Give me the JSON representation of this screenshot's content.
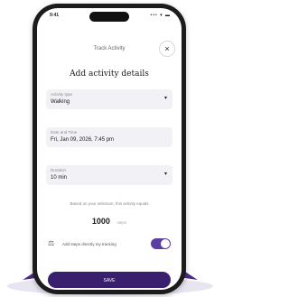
{
  "status_bar": {
    "time": "9:41",
    "icons": "••• ▾ ▬"
  },
  "nav": {
    "title": "Track Activity",
    "close_label": "×"
  },
  "heading": "Add activity details",
  "fields": [
    {
      "label": "Activity type",
      "value": "Walking"
    },
    {
      "label": "Date and Time",
      "value": "Fri, Jan 09, 2026, 7:45 pm"
    },
    {
      "label": "Duration",
      "value": "10 min"
    }
  ],
  "helper_text": "Based on your selection, this activity equals",
  "steps": {
    "value": "1000",
    "unit": "steps"
  },
  "device": {
    "icon": "device-sync-icon",
    "label": "Add steps directly my tracking",
    "toggle_on": true
  },
  "save_label": "SAVE",
  "colors": {
    "primary": "#3a1f6e",
    "toggle": "#5b3fa0",
    "field_bg": "#f2f1f6",
    "accent": "#4b2a8a"
  }
}
